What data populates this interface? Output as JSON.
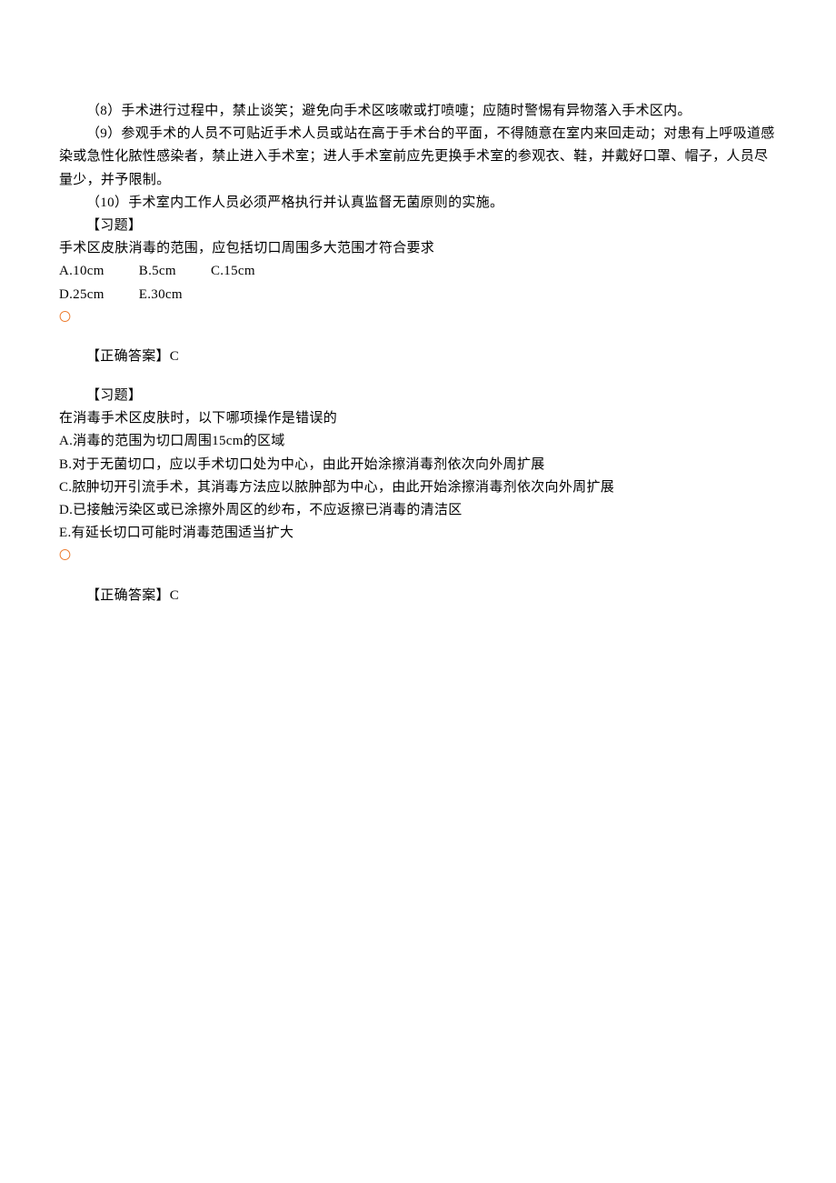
{
  "body": {
    "para8": "（8）手术进行过程中，禁止谈笑；避免向手术区咳嗽或打喷嚏；应随时警惕有异物落入手术区内。",
    "para9": "（9）参观手术的人员不可贴近手术人员或站在高于手术台的平面，不得随意在室内来回走动；对患有上呼吸道感染或急性化脓性感染者，禁止进入手术室；进人手术室前应先更换手术室的参观衣、鞋，并戴好口罩、帽子，人员尽量少，并予限制。",
    "para10": "（10）手术室内工作人员必须严格执行并认真监督无菌原则的实施。"
  },
  "q1": {
    "header": "【习题】",
    "stem": "手术区皮肤消毒的范围，应包括切口周围多大范围才符合要求",
    "optA": "A.10cm",
    "optB": "B.5cm",
    "optC": "C.15cm",
    "optD": "D.25cm",
    "optE": "E.30cm",
    "answer_label": "【正确答案】C"
  },
  "q2": {
    "header": "【习题】",
    "stem": "在消毒手术区皮肤时，以下哪项操作是错误的",
    "optA": "A.消毒的范围为切口周围15cm的区域",
    "optB": "B.对于无菌切口，应以手术切口处为中心，由此开始涂擦消毒剂依次向外周扩展",
    "optC": "C.脓肿切开引流手术，其消毒方法应以脓肿部为中心，由此开始涂擦消毒剂依次向外周扩展",
    "optD": "D.已接触污染区或已涂擦外周区的纱布，不应返擦已消毒的清洁区",
    "optE": "E.有延长切口可能时消毒范围适当扩大",
    "answer_label": "【正确答案】C"
  },
  "circle_glyph": "〇"
}
